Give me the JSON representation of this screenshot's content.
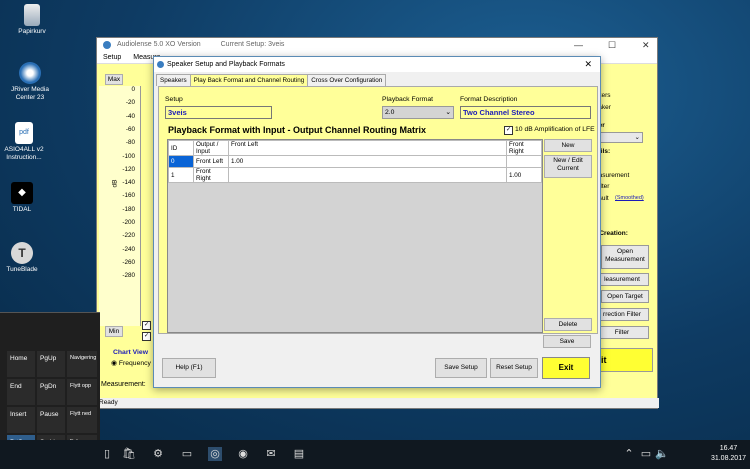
{
  "desktop": {
    "icons": [
      {
        "label": "Papirkurv",
        "icon": "recycle-bin-icon"
      },
      {
        "label": "JRiver Media Center 23",
        "icon": "jriver-icon"
      },
      {
        "label": "ASIO4ALL v2 Instruction...",
        "icon": "pdf-icon"
      },
      {
        "label": "TIDAL",
        "icon": "tidal-icon"
      },
      {
        "label": "TuneBlade",
        "icon": "tuneblade-icon"
      }
    ]
  },
  "main_window": {
    "title": "Audiolense 5.0 XO Version",
    "setup_title": "Current Setup: 3veis",
    "menu": [
      "Setup",
      "Measure"
    ],
    "max_label": "Max",
    "min_label": "Min",
    "y_ticks": [
      "0",
      "-20",
      "-40",
      "-60",
      "-80",
      "-100",
      "-120",
      "-140",
      "-160",
      "-180",
      "-200",
      "-220",
      "-240",
      "-260",
      "-280"
    ],
    "db_label": "dB",
    "chart_view_label": "Chart View",
    "frequency_label": "Frequency",
    "measurement_label": "Measurement:",
    "status": "Ready",
    "right_panel": {
      "text1": "eakers",
      "text2": "peaker",
      "text3": "ker",
      "text4": "tails:",
      "text5": "nt",
      "text6": "easurement",
      "text7": "Filter",
      "text8": "esult",
      "smoothed": "(Smoothed)",
      "creation": "r Creation:",
      "open_measurement": "Open Measurement",
      "measurement": "leasurement",
      "open_target": "Open Target",
      "correction_filter": "rrection Filter",
      "filter": "Filter",
      "exit": "xit"
    }
  },
  "dialog": {
    "title": "Speaker Setup and Playback Formats",
    "tabs": [
      "Speakers",
      "Play Back Format and Channel Routing",
      "Cross Over Configuration"
    ],
    "setup_label": "Setup",
    "setup_value": "3veis",
    "playback_format_label": "Playback Format",
    "playback_format_value": "2.0",
    "format_description_label": "Format Description",
    "format_description_value": "Two Channel Stereo",
    "matrix_title": "Playback Format with Input - Output Channel Routing Matrix",
    "lfe_label": "10 dB Amplification of LFE",
    "lfe_checked": true,
    "table": {
      "headers": [
        "ID",
        "Output / Input",
        "Front Left",
        "Front Right"
      ],
      "rows": [
        [
          "0",
          "Front Left",
          "1.00",
          ""
        ],
        [
          "1",
          "Front Right",
          "",
          "1.00"
        ]
      ]
    },
    "buttons": {
      "new": "New",
      "new_edit": "New / Edit Current",
      "delete": "Delete",
      "save": "Save",
      "help": "Help (F1)",
      "save_setup": "Save Setup",
      "reset_setup": "Reset Setup",
      "exit": "Exit"
    }
  },
  "keyboard": {
    "keys": [
      [
        "Home",
        "PgUp",
        "Navigering"
      ],
      [
        "End",
        "PgDn",
        "Flytt opp"
      ],
      [
        "Insert",
        "Pause",
        "Flytt ned"
      ],
      [
        "PrtScn",
        "ScrLk",
        "Fokusere"
      ]
    ]
  },
  "taskbar": {
    "time": "16.47",
    "date": "31.08.2017"
  }
}
